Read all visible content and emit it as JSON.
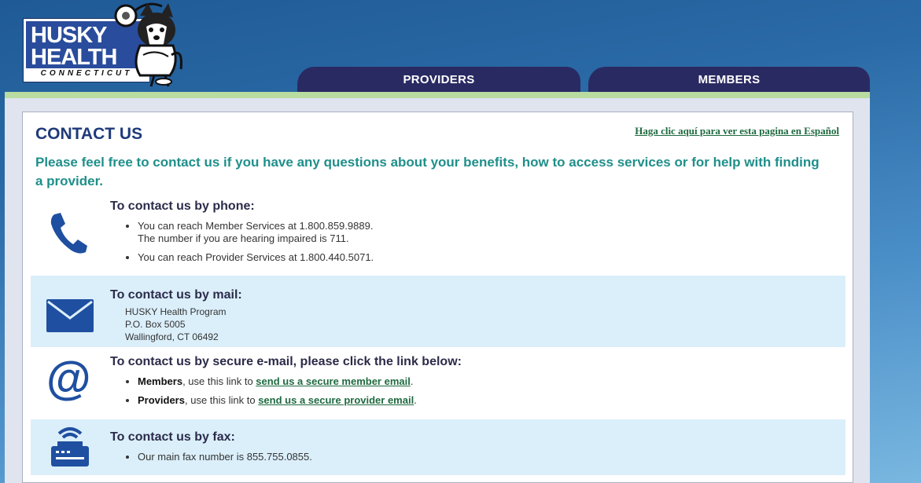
{
  "logo": {
    "line1": "HUSKY",
    "line2": "HEALTH",
    "sub": "CONNECTICUT"
  },
  "nav": {
    "tabs": [
      {
        "label": "PROVIDERS"
      },
      {
        "label": "MEMBERS"
      }
    ]
  },
  "header": {
    "title": "CONTACT US",
    "spanish_link": "Haga clic aquí para ver esta pagina en Español"
  },
  "intro": "Please feel free to contact us if you have any questions about your benefits, how to access services or for help with finding a provider.",
  "phone": {
    "title": "To contact us by phone:",
    "item1_line1": "You can reach Member Services at 1.800.859.9889.",
    "item1_line2": "The number if you are hearing impaired is 711.",
    "item2": "You can reach Provider Services at 1.800.440.5071."
  },
  "mail": {
    "title": "To contact us by mail:",
    "line1": "HUSKY Health Program",
    "line2": "P.O. Box 5005",
    "line3": "Wallingford, CT 06492"
  },
  "email": {
    "title": "To contact us by secure e-mail, please click the link below:",
    "members_kw": "Members",
    "members_text": ", use this link to ",
    "members_link": "send us a secure member email",
    "providers_kw": "Providers",
    "providers_text": ", use this link to ",
    "providers_link": "send us a secure provider email",
    "period": "."
  },
  "fax": {
    "title": "To contact us by fax:",
    "item1": "Our main fax number is 855.755.0855."
  },
  "colors": {
    "navy": "#2a2a63",
    "teal": "#1f8f8a",
    "link_green": "#1e6a3f",
    "icon_blue": "#1f4fa0",
    "alt_row": "#dbeffb"
  }
}
